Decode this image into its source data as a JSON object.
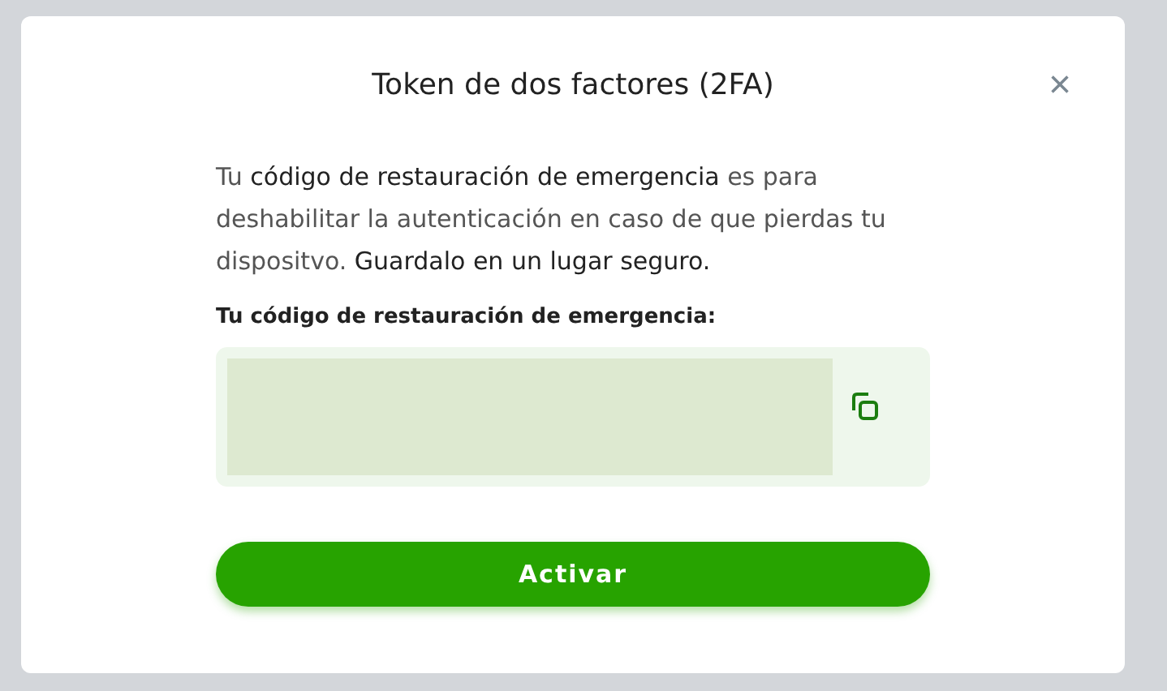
{
  "dialog": {
    "title": "Token de dos factores (2FA)",
    "close": "×",
    "description": "Tu **código de restauración de emergencia** es para deshabilitar la autenticación en caso de que pierdas tu dispositvo. **Guardalo en un lugar seguro.**",
    "code_label": "Tu código de restauración de emergencia:",
    "primary_button": "Activar"
  }
}
